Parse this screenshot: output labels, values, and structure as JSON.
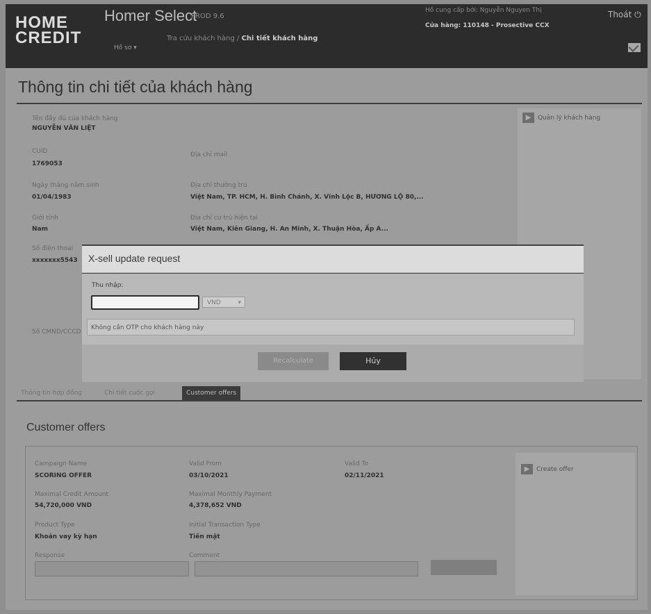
{
  "header": {
    "logo_line1": "HOME",
    "logo_line2": "CREDIT",
    "app_title": "Homer Select",
    "app_version": "PROD 9.6",
    "breadcrumb_parent": "Tra cứu khách hàng",
    "breadcrumb_sep": "/",
    "breadcrumb_current": "Chi tiết khách hàng",
    "menu_label": "Hồ sơ ▾",
    "user_name": "Hồ cung cấp bởi: Nguyễn Nguyen Thị",
    "branch": "Cửa hàng: 110148 - Prosective CCX",
    "logout_label": "Thoát ⏻",
    "mail_icon": "mail-icon"
  },
  "page_title": "Thông tin chi tiết của khách hàng",
  "customer": {
    "name_label": "Tên đầy đủ của khách hàng",
    "name_value": "NGUYỄN VĂN LIỆT",
    "cuid_label": "CUID",
    "cuid_value": "1769053",
    "email_label": "Địa chỉ mail",
    "dob_label": "Ngày tháng năm sinh",
    "dob_value": "01/04/1983",
    "permanent_addr_label": "Địa chỉ thường trú",
    "permanent_addr_value": "Việt Nam, TP. HCM, H. Bình Chánh, X. Vĩnh Lộc B, HƯƠNG LỘ 80,...",
    "gender_label": "Giới tính",
    "gender_value": "Nam",
    "current_addr_label": "Địa chỉ cư trú hiện tại",
    "current_addr_value": "Việt Nam, Kiên Giang, H. An Minh, X. Thuận Hòa, Ấp A...",
    "phone_label": "Số điện thoại",
    "phone_value": "xxxxxxx5543",
    "id_label": "Số CMND/CCCD",
    "side_button": "Quản lý khách hàng"
  },
  "tabs": [
    "Thông tin hợp đồng",
    "Chi tiết cuộc gọi",
    "Customer offers"
  ],
  "offers": {
    "title": "Customer offers",
    "campaign_label": "Campaign Name",
    "campaign_value": "SCORING OFFER",
    "valid_from_label": "Valid From",
    "valid_from_value": "03/10/2021",
    "valid_to_label": "Valid To",
    "valid_to_value": "02/11/2021",
    "max_credit_label": "Maximal Credit Amount",
    "max_credit_value": "54,720,000 VND",
    "max_monthly_label": "Maximal Monthly Payment",
    "max_monthly_value": "4,378,652 VND",
    "product_type_label": "Product Type",
    "product_type_value": "Khoản vay kỳ hạn",
    "transaction_type_label": "Initial Transaction Type",
    "transaction_type_value": "Tiền mặt",
    "response_label": "Response",
    "comment_label": "Comment",
    "side_button": "Create offer"
  },
  "modal": {
    "title": "X-sell update request",
    "limit_label": "Thu nhập:",
    "limit_value": "",
    "currency_value": "VND",
    "notice": "Không cần OTP cho khách hàng này",
    "recalculate_label": "Recalculate",
    "cancel_label": "Hủy"
  }
}
